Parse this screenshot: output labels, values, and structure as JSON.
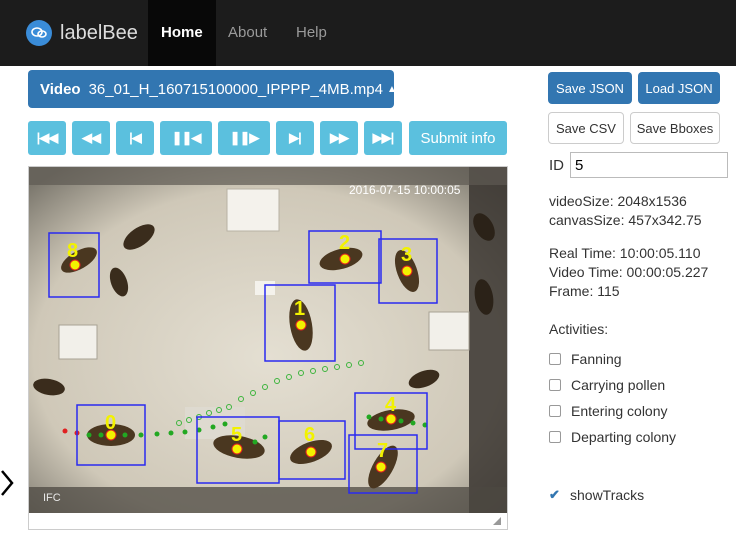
{
  "navbar": {
    "brand": "labelBee",
    "items": [
      "Home",
      "About",
      "Help"
    ]
  },
  "video": {
    "label": "Video",
    "filename": "36_01_H_160715100000_IPPPP_4MB.mp4"
  },
  "controls": {
    "submit_label": "Submit info"
  },
  "actions": {
    "save_json": "Save JSON",
    "load_json": "Load JSON",
    "save_csv": "Save CSV",
    "save_bboxes": "Save Bboxes"
  },
  "id_field": {
    "label": "ID",
    "value": "5"
  },
  "info": {
    "video_size": "videoSize: 2048x1536",
    "canvas_size": "canvasSize: 457x342.75",
    "real_time": "Real Time: 10:00:05.110",
    "video_time": "Video Time: 00:00:05.227",
    "frame": "Frame: 115"
  },
  "activities": {
    "title": "Activities:",
    "items": [
      {
        "label": "Fanning",
        "checked": false
      },
      {
        "label": "Carrying pollen",
        "checked": false
      },
      {
        "label": "Entering colony",
        "checked": false
      },
      {
        "label": "Departing colony",
        "checked": false
      }
    ]
  },
  "show_tracks": {
    "label": "showTracks",
    "checked": true
  },
  "video_frame": {
    "timestamp": "2016-07-15 10:00:05",
    "corner_text": "IFC",
    "bee_ids": [
      "0",
      "1",
      "2",
      "3",
      "4",
      "5",
      "6",
      "7",
      "8"
    ]
  },
  "colors": {
    "accent": "#3276b1",
    "control_button": "#5bc0de",
    "navbar": "#1c1c1c",
    "bbox": "#2a2af0",
    "label": "#f2f200"
  }
}
